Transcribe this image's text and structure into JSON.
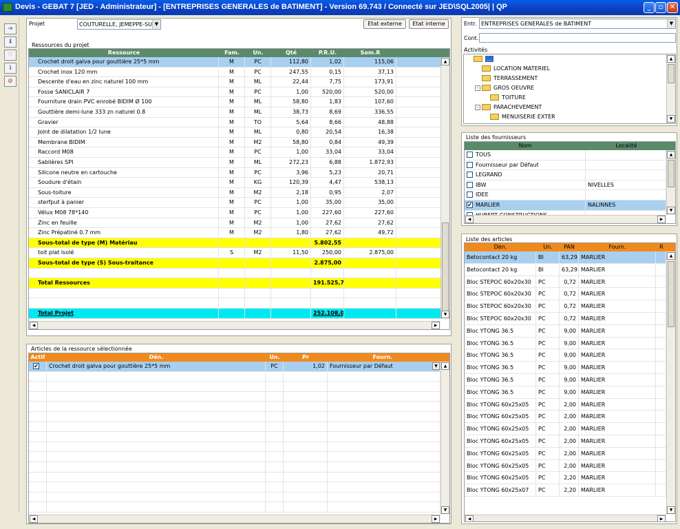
{
  "window": {
    "title": "Devis - GEBAT 7 [JED - Administrateur] - [ENTREPRISES GENERALES de BATIMENT]  - Version 69.743 / Connecté sur JED\\SQL2005| | QP"
  },
  "projet": {
    "label": "Projet",
    "value": "COUTURELLE, JEMEPPE-SUR-",
    "btn_externe": "Etat externe",
    "btn_interne": "Etat interne"
  },
  "ressources": {
    "title": "Ressources du projet",
    "columns": [
      "Ressource",
      "Fam.",
      "Un.",
      "Qté",
      "P.R.U.",
      "Som.R"
    ],
    "rows": [
      {
        "name": "Crochet droit galva pour gouttière 25*5 mm",
        "fam": "M",
        "un": "PC",
        "qte": "112,80",
        "pru": "1,02",
        "som": "115,06",
        "style": "selected"
      },
      {
        "name": "Crochet inox 120 mm",
        "fam": "M",
        "un": "PC",
        "qte": "247,55",
        "pru": "0,15",
        "som": "37,13",
        "style": ""
      },
      {
        "name": "Descente d'eau en zinc naturel  100 mm",
        "fam": "M",
        "un": "ML",
        "qte": "22,44",
        "pru": "7,75",
        "som": "173,91",
        "style": ""
      },
      {
        "name": "Fosse SANICLAIR  7",
        "fam": "M",
        "un": "PC",
        "qte": "1,00",
        "pru": "520,00",
        "som": "520,00",
        "style": ""
      },
      {
        "name": "Fourniture drain PVC enrobé BIDIM Ø 100",
        "fam": "M",
        "un": "ML",
        "qte": "58,80",
        "pru": "1,83",
        "som": "107,60",
        "style": ""
      },
      {
        "name": "Gouttière demi-lune 333 zn naturel 0.8",
        "fam": "M",
        "un": "ML",
        "qte": "38,73",
        "pru": "8,69",
        "som": "336,55",
        "style": ""
      },
      {
        "name": "Gravier",
        "fam": "M",
        "un": "TO",
        "qte": "5,64",
        "pru": "8,66",
        "som": "48,88",
        "style": ""
      },
      {
        "name": "Joint de dilatation 1/2 lune",
        "fam": "M",
        "un": "ML",
        "qte": "0,80",
        "pru": "20,54",
        "som": "16,38",
        "style": ""
      },
      {
        "name": "Membrane BIDIM",
        "fam": "M",
        "un": "M2",
        "qte": "58,80",
        "pru": "0,84",
        "som": "49,39",
        "style": ""
      },
      {
        "name": "Raccord M08",
        "fam": "M",
        "un": "PC",
        "qte": "1,00",
        "pru": "33,04",
        "som": "33,04",
        "style": ""
      },
      {
        "name": "Sablières SPI",
        "fam": "M",
        "un": "ML",
        "qte": "272,23",
        "pru": "6,88",
        "som": "1.872,93",
        "style": ""
      },
      {
        "name": "Silicone neutre en cartouche",
        "fam": "M",
        "un": "PC",
        "qte": "3,96",
        "pru": "5,23",
        "som": "20,71",
        "style": ""
      },
      {
        "name": "Soudure d'étain",
        "fam": "M",
        "un": "KG",
        "qte": "120,39",
        "pru": "4,47",
        "som": "538,13",
        "style": ""
      },
      {
        "name": "Sous-toiture",
        "fam": "M",
        "un": "M2",
        "qte": "2,18",
        "pru": "0,95",
        "som": "2,07",
        "style": ""
      },
      {
        "name": "sterfput à panier",
        "fam": "M",
        "un": "PC",
        "qte": "1,00",
        "pru": "35,00",
        "som": "35,00",
        "style": ""
      },
      {
        "name": "Vélux M08 78*140",
        "fam": "M",
        "un": "PC",
        "qte": "1,00",
        "pru": "227,60",
        "som": "227,60",
        "style": ""
      },
      {
        "name": "Zinc en feuille",
        "fam": "M",
        "un": "M2",
        "qte": "1,00",
        "pru": "27,62",
        "som": "27,62",
        "style": ""
      },
      {
        "name": "Zinc Prépatiné 0.7 mm",
        "fam": "M",
        "un": "M2",
        "qte": "1,80",
        "pru": "27,62",
        "som": "49,72",
        "style": ""
      },
      {
        "name": "Sous-total de type (M) Matériau",
        "fam": "",
        "un": "",
        "qte": "",
        "pru": "5.802,55",
        "som": "",
        "style": "subtotal"
      },
      {
        "name": "toit plat isolé",
        "fam": "S",
        "un": "M2",
        "qte": "11,50",
        "pru": "250,00",
        "som": "2.875,00",
        "style": ""
      },
      {
        "name": "Sous-total de type (S) Sous-traitance",
        "fam": "",
        "un": "",
        "qte": "",
        "pru": "2.875,00",
        "som": "",
        "style": "subtotal"
      },
      {
        "name": "",
        "fam": "",
        "un": "",
        "qte": "",
        "pru": "",
        "som": "",
        "style": ""
      },
      {
        "name": "Total Ressources",
        "fam": "",
        "un": "",
        "qte": "",
        "pru": "191.525,71",
        "som": "",
        "style": "subtotal"
      },
      {
        "name": "",
        "fam": "",
        "un": "",
        "qte": "",
        "pru": "",
        "som": "",
        "style": ""
      },
      {
        "name": "",
        "fam": "",
        "un": "",
        "qte": "",
        "pru": "",
        "som": "",
        "style": ""
      },
      {
        "name": "Total Projet",
        "fam": "",
        "un": "",
        "qte": "",
        "pru": "252.108,02",
        "som": "",
        "style": "total"
      }
    ]
  },
  "articles_ressource": {
    "title": "Articles de la ressource sélectionnée",
    "columns": [
      "Actif",
      "Dén.",
      "Un.",
      "Pr",
      "Fourn."
    ],
    "rows": [
      {
        "actif": "✔",
        "den": "Crochet droit galva pour gouttière 25*5 mm",
        "un": "PC",
        "pr": "1,02",
        "fourn": "Fournisseur par Défaut"
      }
    ]
  },
  "entreprise": {
    "label": "Entr.",
    "value": "ENTREPRISES GENERALES de BATIMENT",
    "cont_label": "Cont.",
    "activites_label": "Activités"
  },
  "activites_tree": [
    {
      "label": "...",
      "level": 0,
      "expander": "",
      "selected": true
    },
    {
      "label": "LOCATION MATERIEL",
      "level": 1,
      "expander": ""
    },
    {
      "label": "TERRASSEMENT",
      "level": 1,
      "expander": ""
    },
    {
      "label": "GROS OEUVRE",
      "level": 1,
      "expander": "-"
    },
    {
      "label": "TOITURE",
      "level": 2,
      "expander": ""
    },
    {
      "label": "PARACHEVEMENT",
      "level": 1,
      "expander": "-"
    },
    {
      "label": "MENUISERIE EXTER",
      "level": 2,
      "expander": ""
    }
  ],
  "fournisseurs": {
    "title": "Liste des fournisseurs",
    "columns": [
      "Nom",
      "Localité"
    ],
    "rows": [
      {
        "checked": "",
        "nom": "TOUS",
        "loc": ""
      },
      {
        "checked": "",
        "nom": "Fournisseur par Défaut",
        "loc": ""
      },
      {
        "checked": "",
        "nom": "LEGRAND",
        "loc": ""
      },
      {
        "checked": "",
        "nom": "IBW",
        "loc": "NIVELLES"
      },
      {
        "checked": "",
        "nom": "IDEE",
        "loc": ""
      },
      {
        "checked": "✔",
        "nom": "MARLIER",
        "loc": "NALINNES",
        "selected": true
      },
      {
        "checked": "",
        "nom": "HUBERT CONSTRUCTIONS",
        "loc": ""
      }
    ]
  },
  "liste_articles": {
    "title": "Liste des articles",
    "columns": [
      "Dén.",
      "Un.",
      "PAN",
      "Fourn.",
      "R"
    ],
    "rows": [
      {
        "den": "Betocontact 20 kg",
        "un": "BI",
        "pan": "63,29",
        "fourn": "MARLIER",
        "selected": true
      },
      {
        "den": "Betocontact 20 kg",
        "un": "BI",
        "pan": "63,29",
        "fourn": "MARLIER"
      },
      {
        "den": "Bloc STEPOC 60x20x30",
        "un": "PC",
        "pan": "0,72",
        "fourn": "MARLIER"
      },
      {
        "den": "Bloc STEPOC 60x20x30",
        "un": "PC",
        "pan": "0,72",
        "fourn": "MARLIER"
      },
      {
        "den": "Bloc STEPOC 60x20x30",
        "un": "PC",
        "pan": "0,72",
        "fourn": "MARLIER"
      },
      {
        "den": "Bloc STEPOC 60x20x30",
        "un": "PC",
        "pan": "0,72",
        "fourn": "MARLIER"
      },
      {
        "den": "Bloc YTONG  36.5",
        "un": "PC",
        "pan": "9,00",
        "fourn": "MARLIER"
      },
      {
        "den": "Bloc YTONG  36.5",
        "un": "PC",
        "pan": "9,00",
        "fourn": "MARLIER"
      },
      {
        "den": "Bloc YTONG  36.5",
        "un": "PC",
        "pan": "9,00",
        "fourn": "MARLIER"
      },
      {
        "den": "Bloc YTONG  36.5",
        "un": "PC",
        "pan": "9,00",
        "fourn": "MARLIER"
      },
      {
        "den": "Bloc YTONG  36.5",
        "un": "PC",
        "pan": "9,00",
        "fourn": "MARLIER"
      },
      {
        "den": "Bloc YTONG  36.5",
        "un": "PC",
        "pan": "9,00",
        "fourn": "MARLIER"
      },
      {
        "den": "Bloc YTONG 60x25x05",
        "un": "PC",
        "pan": "2,00",
        "fourn": "MARLIER"
      },
      {
        "den": "Bloc YTONG 60x25x05",
        "un": "PC",
        "pan": "2,00",
        "fourn": "MARLIER"
      },
      {
        "den": "Bloc YTONG 60x25x05",
        "un": "PC",
        "pan": "2,00",
        "fourn": "MARLIER"
      },
      {
        "den": "Bloc YTONG 60x25x05",
        "un": "PC",
        "pan": "2,00",
        "fourn": "MARLIER"
      },
      {
        "den": "Bloc YTONG 60x25x05",
        "un": "PC",
        "pan": "2,00",
        "fourn": "MARLIER"
      },
      {
        "den": "Bloc YTONG 60x25x05",
        "un": "PC",
        "pan": "2,00",
        "fourn": "MARLIER"
      },
      {
        "den": "Bloc YTONG 60x25x05",
        "un": "PC",
        "pan": "2,20",
        "fourn": "MARLIER"
      },
      {
        "den": "Bloc YTONG 60x25x07",
        "un": "PC",
        "pan": "2,20",
        "fourn": "MARLIER"
      }
    ]
  },
  "colors": {
    "header_green": "#5a8a6a",
    "header_orange": "#f08a1c",
    "selected": "#a8cff0",
    "subtotal": "#ffff00",
    "total": "#00e8f0"
  }
}
